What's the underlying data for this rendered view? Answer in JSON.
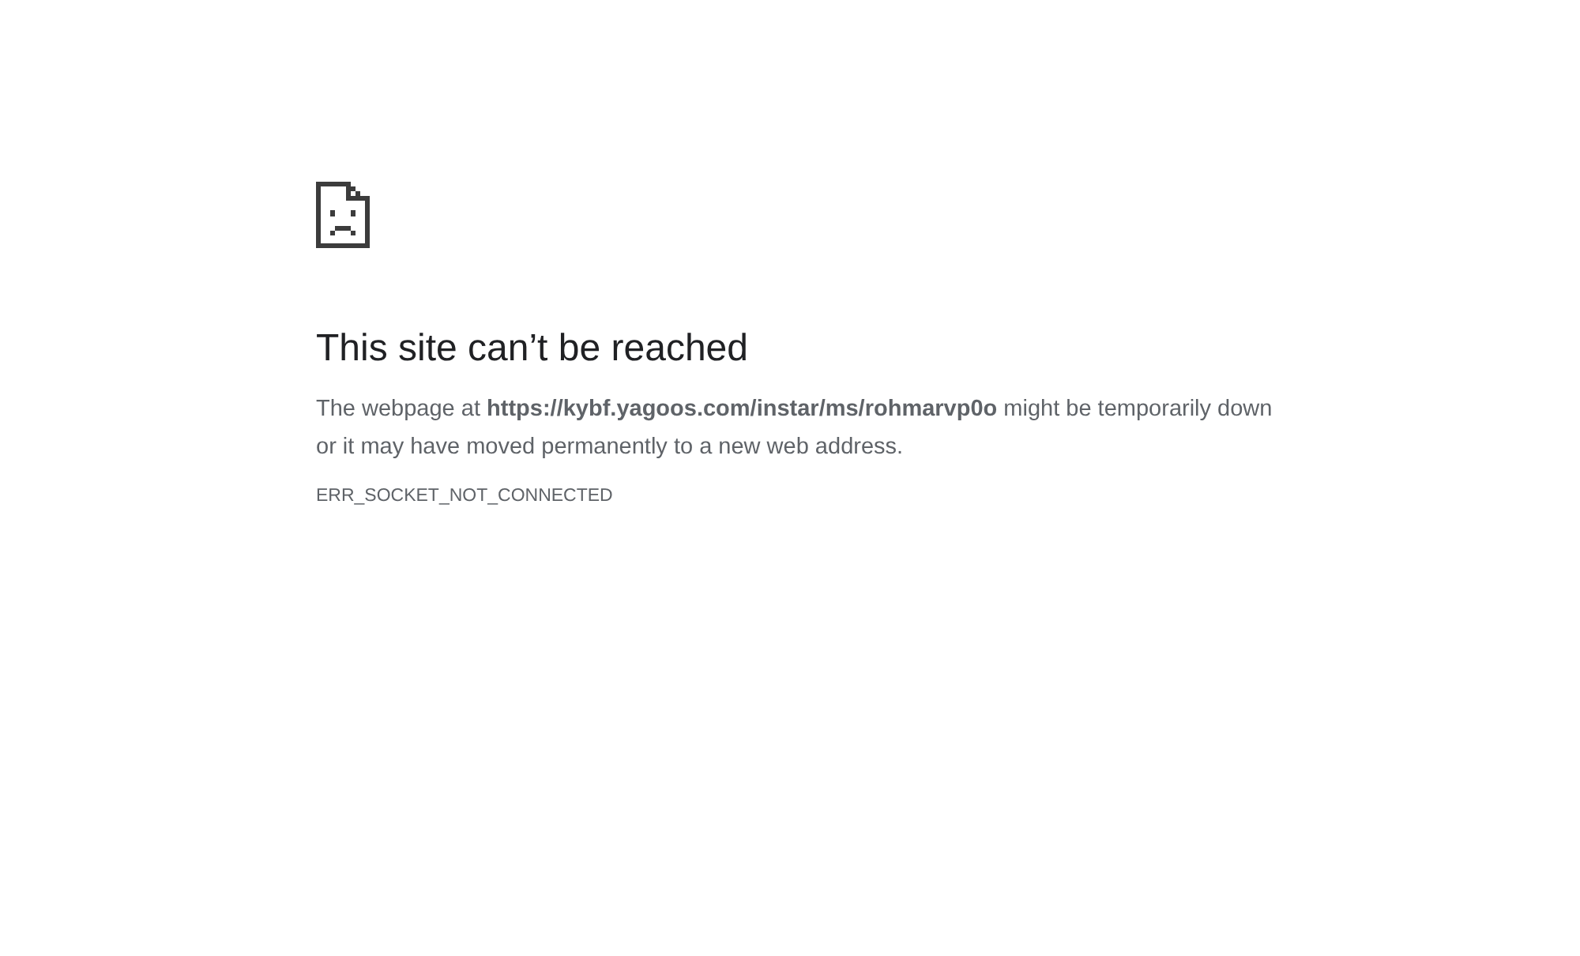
{
  "heading": "This site can’t be reached",
  "message": "The webpage at **https://kybf.yagoos.com/instar/ms/rohmarvp0o** might be temporarily down or it may have moved permanently to a new web address.",
  "error_code": "ERR_SOCKET_NOT_CONNECTED"
}
